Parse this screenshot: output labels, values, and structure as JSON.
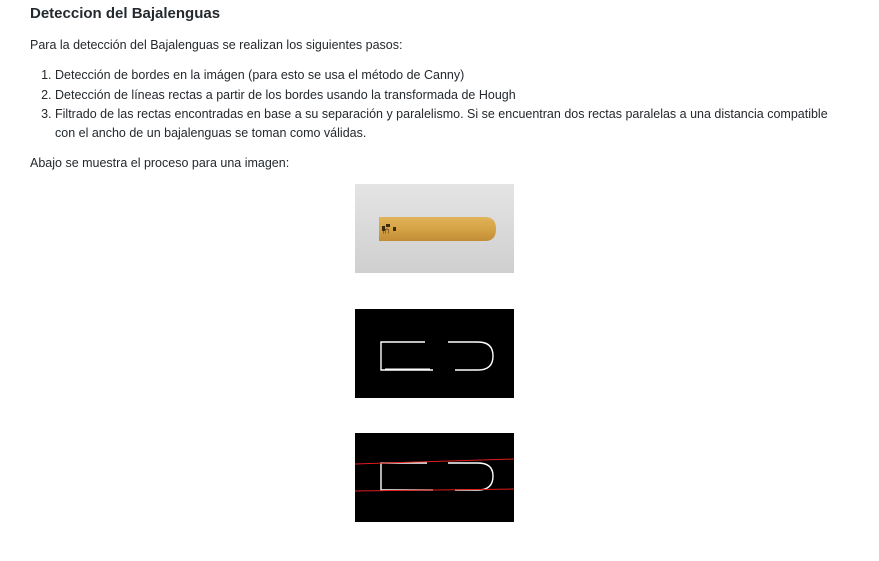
{
  "section": {
    "title": "Deteccion del Bajalenguas",
    "intro": "Para la detección del Bajalenguas se realizan los siguientes pasos:",
    "steps": [
      "Detección de bordes en la imágen (para esto se usa el método de Canny)",
      "Detección de líneas rectas a partir de los bordes usando la transformada de Hough",
      "Filtrado de las rectas encontradas en base a su separación y paralelismo. Si se encuentran dos rectas paralelas a una distancia compatible con el ancho de un bajalenguas se toman como válidas."
    ],
    "process_caption": "Abajo se muestra el proceso para una imagen:"
  },
  "images": [
    {
      "name": "original-photo",
      "bg": "#d9d9d9",
      "stick_color": "#d7a44a"
    },
    {
      "name": "canny-edges",
      "bg": "#000000",
      "edge_color": "#ffffff"
    },
    {
      "name": "hough-lines",
      "bg": "#000000",
      "edge_color": "#ffffff",
      "line_color": "#e01b1b"
    }
  ]
}
